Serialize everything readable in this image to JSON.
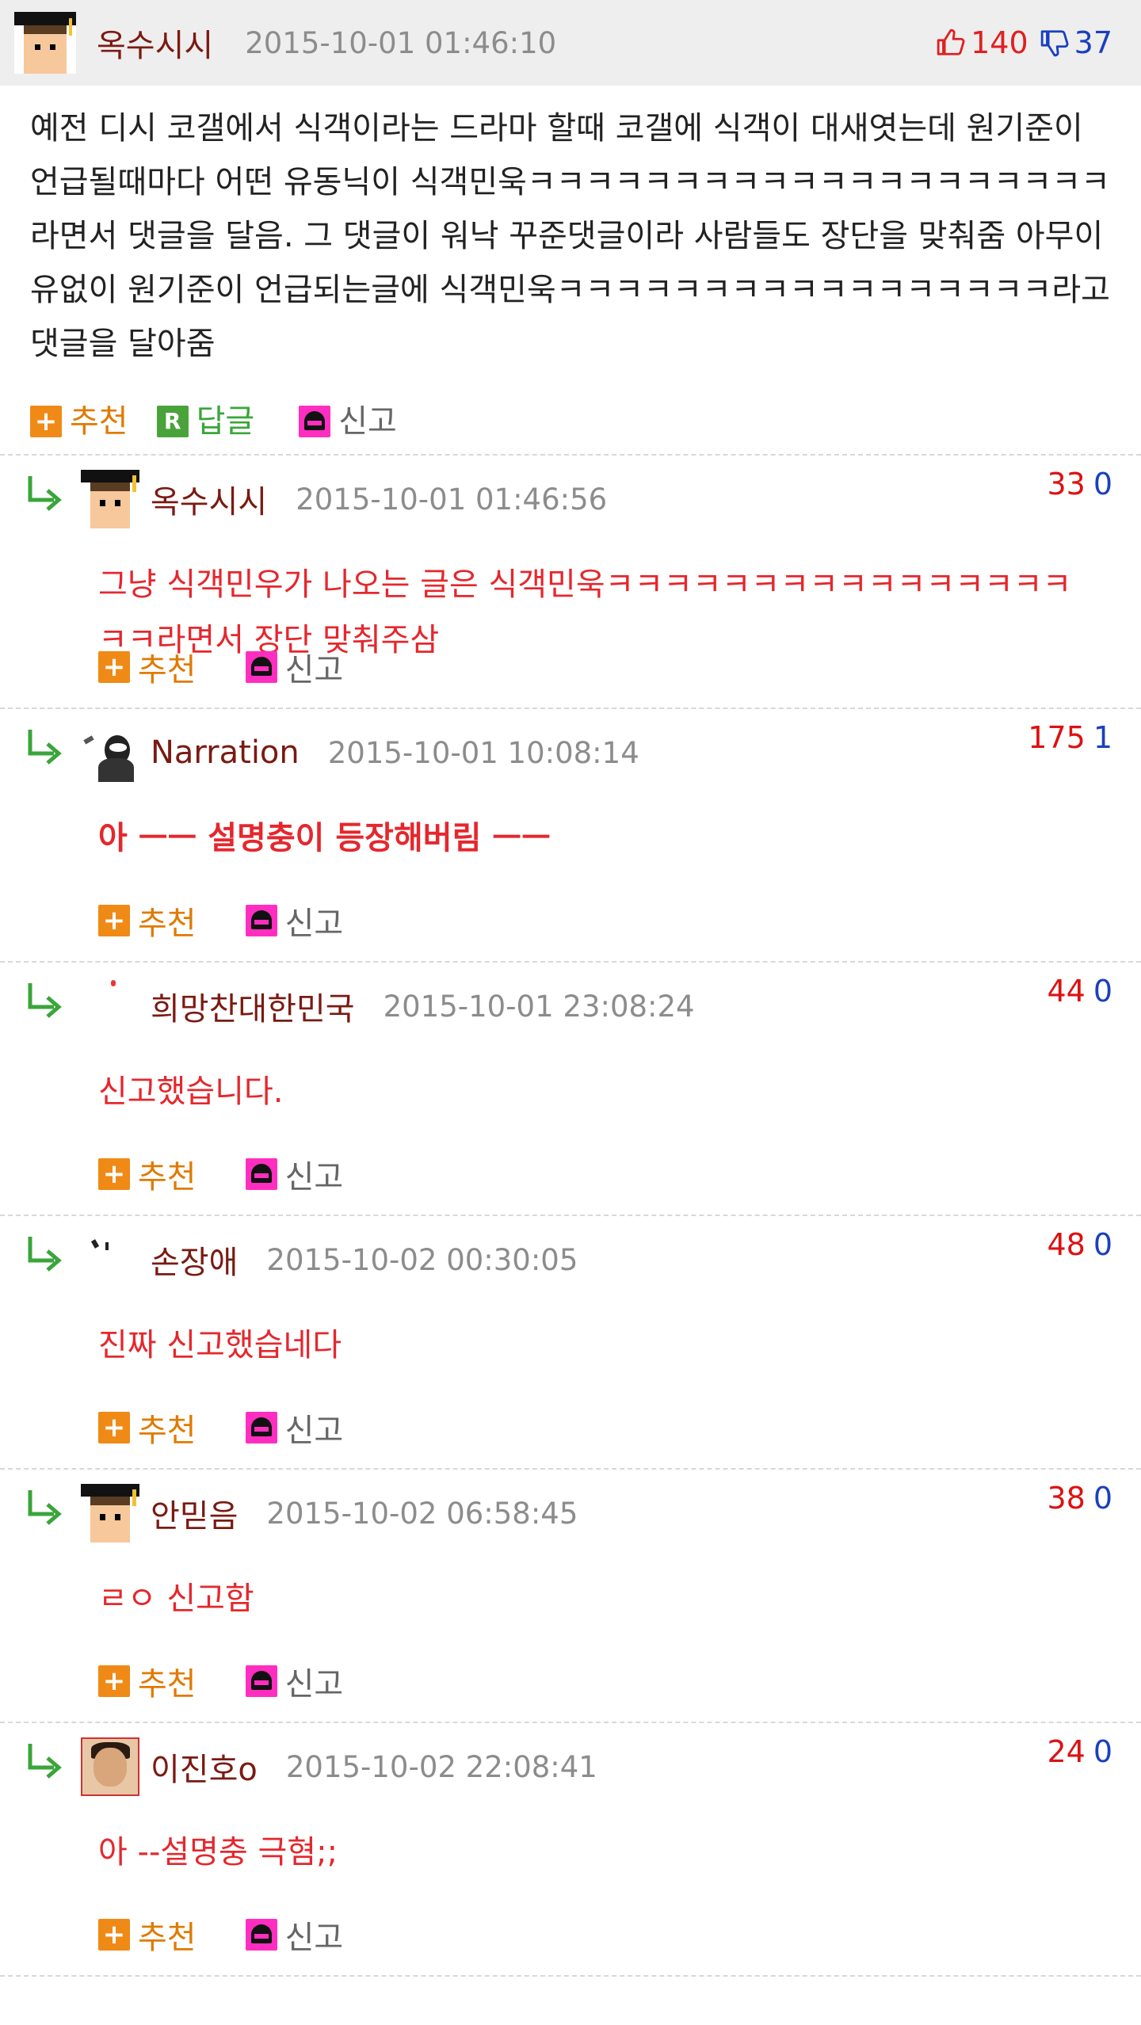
{
  "post": {
    "author": "옥수시시",
    "date": "2015-10-01 01:46:10",
    "upvotes": "140",
    "downvotes": "37",
    "body": "예전 디시 코갤에서 식객이라는 드라마 할때 코갤에 식객이 대새엿는데 원기준이 언급될때마다 어떤 유동닉이 식객민욱ㅋㅋㅋㅋㅋㅋㅋㅋㅋㅋㅋㅋㅋㅋㅋㅋㅋㅋㅋㅋ라면서 댓글을 달음. 그 댓글이 워낙 꾸준댓글이라 사람들도 장단을 맞춰줌 아무이유없이 원기준이 언급되는글에 식객민욱ㅋㅋㅋㅋㅋㅋㅋㅋㅋㅋㅋㅋㅋㅋㅋㅋㅋ라고 댓글을 달아줌",
    "actions": {
      "recommend": "추천",
      "reply": "답글",
      "report": "신고"
    }
  },
  "comment_actions": {
    "recommend": "추천",
    "report": "신고"
  },
  "comments": [
    {
      "author": "옥수시시",
      "date": "2015-10-01 01:46:56",
      "up": "33",
      "down": "0",
      "avatar": "graduate-avatar",
      "text": "그냥 식객민우가 나오는 글은 식객민욱ㅋㅋㅋㅋㅋㅋㅋㅋㅋㅋㅋㅋㅋㅋㅋㅋㅋㅋ라면서 장단 맞춰주삼"
    },
    {
      "author": "Narration",
      "date": "2015-10-01 10:08:14",
      "up": "175",
      "down": "1",
      "avatar": "monochrome-avatar",
      "text": "아 ㅡㅡ 설명충이 등장해버림 ㅡㅡ"
    },
    {
      "author": "희망찬대한민국",
      "date": "2015-10-01 23:08:24",
      "up": "44",
      "down": "0",
      "avatar": "dot-avatar",
      "text": "신고했습니다."
    },
    {
      "author": "손장애",
      "date": "2015-10-02 00:30:05",
      "up": "48",
      "down": "0",
      "avatar": "dots-avatar",
      "text": "진짜 신고했습네다"
    },
    {
      "author": "안믿음",
      "date": "2015-10-02 06:58:45",
      "up": "38",
      "down": "0",
      "avatar": "graduate-avatar",
      "text": "ㄹㅇ 신고함"
    },
    {
      "author": "이진호o",
      "date": "2015-10-02 22:08:41",
      "up": "24",
      "down": "0",
      "avatar": "photo-avatar",
      "text": "아 --설명충 극혐;;"
    }
  ],
  "colors": {
    "nick": "#7a1a12",
    "date": "#8c8c8c",
    "comment_text": "#e5272d",
    "recommend": "#e07a00",
    "reply": "#3aa53a",
    "upvote": "#e02020",
    "downvote": "#1a3fc0",
    "header_bg": "#eeeeee"
  }
}
